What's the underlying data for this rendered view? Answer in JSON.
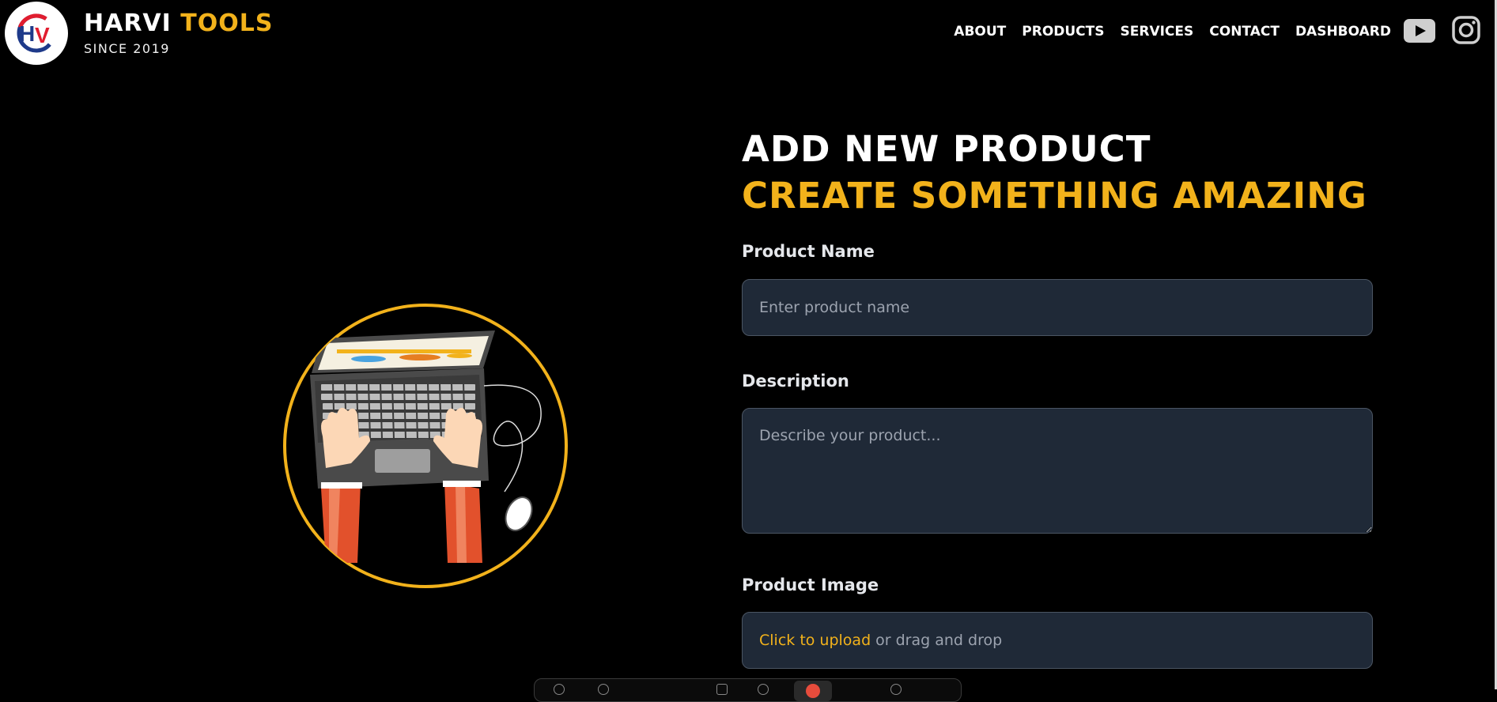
{
  "brand": {
    "title_part1": "HARVI",
    "title_part2": "TOOLS",
    "subtitle": "SINCE 2019",
    "logo_text": "HV"
  },
  "nav": {
    "items": [
      {
        "label": "ABOUT"
      },
      {
        "label": "PRODUCTS"
      },
      {
        "label": "SERVICES"
      },
      {
        "label": "CONTACT"
      },
      {
        "label": "DASHBOARD"
      }
    ],
    "social_icons": [
      "youtube-icon",
      "instagram-icon"
    ]
  },
  "hero": {
    "heading": "ADD NEW PRODUCT",
    "subheading": "CREATE SOMETHING AMAZING"
  },
  "form": {
    "name_label": "Product Name",
    "name_placeholder": "Enter product name",
    "name_value": "",
    "description_label": "Description",
    "description_placeholder": "Describe your product...",
    "description_value": "",
    "image_label": "Product Image",
    "upload_link": "Click to upload",
    "upload_text": "or drag and drop"
  },
  "colors": {
    "accent": "#f2b21b",
    "background": "#000000",
    "field_bg": "#1f2937",
    "field_border": "#4b5563"
  }
}
